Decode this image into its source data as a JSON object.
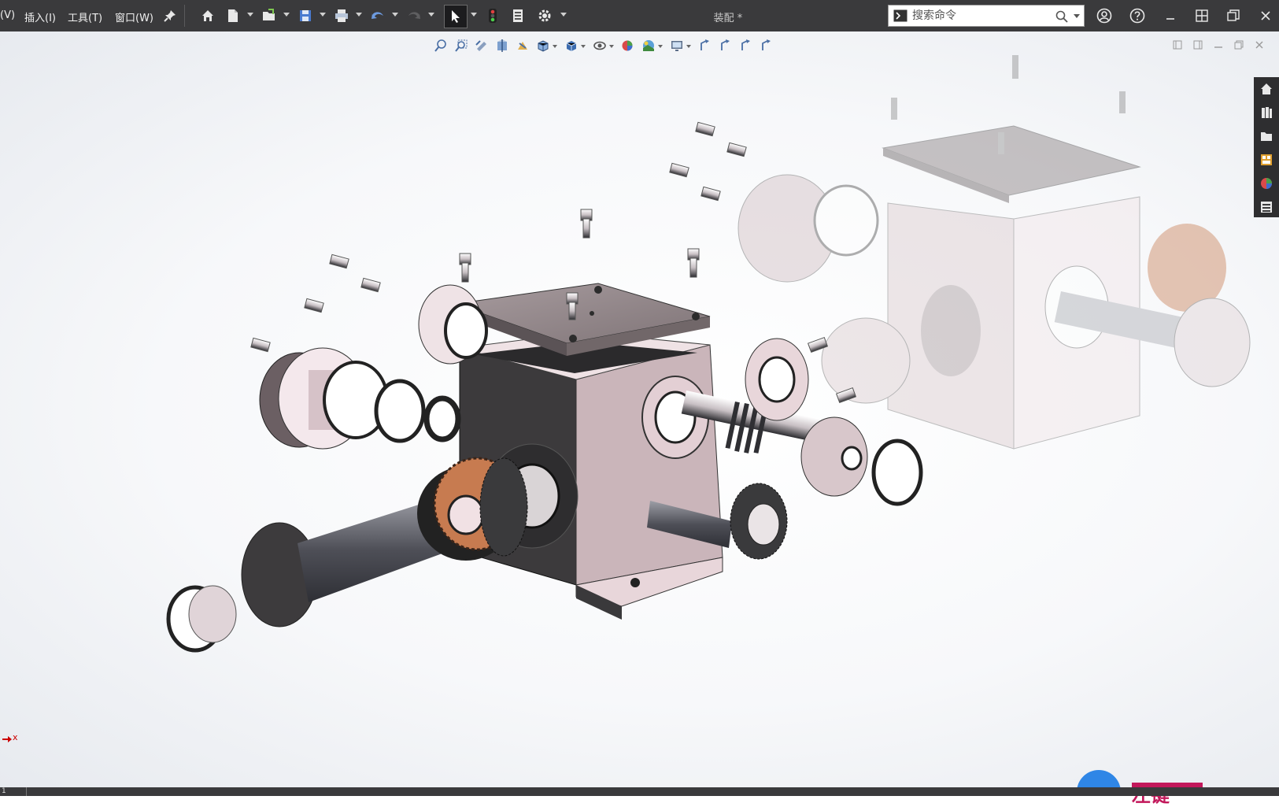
{
  "menu": {
    "view_partial": "(V)",
    "insert": "插入(I)",
    "tools": "工具(T)",
    "window": "窗口(W)"
  },
  "toolbar": {
    "icons": [
      "pin-icon",
      "home-icon",
      "new-document-icon",
      "open-icon",
      "save-icon",
      "print-icon",
      "undo-icon",
      "redo-icon",
      "select-pointer-icon",
      "traffic-light-icon",
      "file-properties-icon",
      "options-gear-icon"
    ]
  },
  "document": {
    "title": "装配 *"
  },
  "search": {
    "placeholder": "搜索命令",
    "value": ""
  },
  "view_toolbar": {
    "icons": [
      "zoom-to-fit-icon",
      "zoom-to-area-icon",
      "previous-view-icon",
      "section-view-icon",
      "dynamic-annotation-icon",
      "view-orientation-icon",
      "display-style-icon",
      "hide-show-items-icon",
      "edit-appearance-icon",
      "apply-scene-icon",
      "view-settings-icon",
      "rotate-view-icon-1",
      "rotate-view-icon-2",
      "rotate-view-icon-3",
      "rotate-view-icon-4"
    ]
  },
  "taskpane": {
    "icons": [
      "solidworks-resources-icon",
      "design-library-icon",
      "file-explorer-icon",
      "view-palette-icon",
      "appearances-icon",
      "custom-properties-icon"
    ]
  },
  "triad": {
    "x_label": "x"
  },
  "status": {
    "cell": "1"
  },
  "watermark": {
    "text": "左键"
  },
  "colors": {
    "titlebar": "#3a3a3c",
    "housing_dark": "#3c3a3c",
    "housing_light": "#c9b3b8",
    "gear_copper": "#c77b50",
    "accent_pink": "#e7c9cf",
    "background": "#ffffff"
  }
}
